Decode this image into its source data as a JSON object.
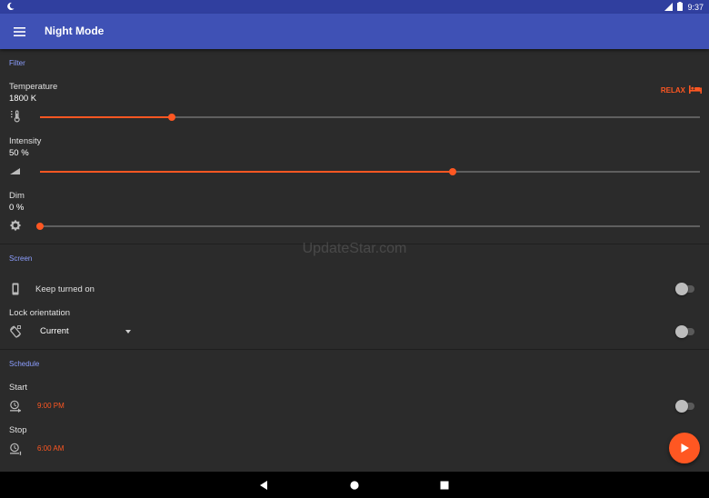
{
  "status_bar": {
    "time": "9:37",
    "moon_icon": "moon-icon",
    "battery_icon": "battery-icon",
    "signal_icon": "signal-icon"
  },
  "app_bar": {
    "title": "Night Mode",
    "menu_icon": "menu-icon"
  },
  "filter": {
    "section_label": "Filter",
    "relax_label": "RELAX",
    "temperature": {
      "label": "Temperature",
      "value": "1800 K",
      "level": 0.2
    },
    "intensity": {
      "label": "Intensity",
      "value": "50 %",
      "level": 0.625
    },
    "dim": {
      "label": "Dim",
      "value": "0 %",
      "level": 0.0
    }
  },
  "screen": {
    "section_label": "Screen",
    "keep_on_label": "Keep turned on",
    "keep_on_enabled": false,
    "lock_orientation_label": "Lock orientation",
    "orientation_value": "Current",
    "lock_orientation_enabled": false
  },
  "schedule": {
    "section_label": "Schedule",
    "start_label": "Start",
    "start_time": "9:00 PM",
    "stop_label": "Stop",
    "stop_time": "6:00 AM",
    "enabled": false
  },
  "watermark": "UpdateStar.com",
  "colors": {
    "accent": "#ff5722",
    "primary": "#3f51b5",
    "primary_dark": "#303f9f",
    "background": "#2b2b2b",
    "section_label": "#8c9eff"
  }
}
